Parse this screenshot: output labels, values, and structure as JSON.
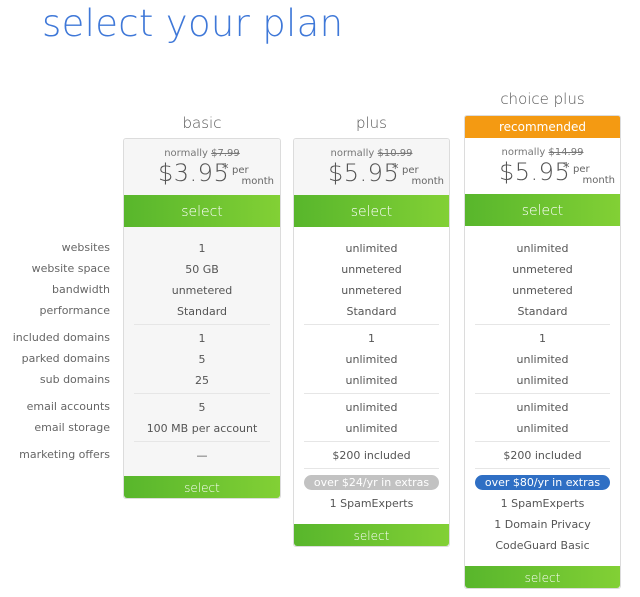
{
  "page": {
    "title": "select your plan"
  },
  "features": {
    "labels": [
      "websites",
      "website space",
      "bandwidth",
      "performance",
      "included domains",
      "parked domains",
      "sub domains",
      "email accounts",
      "email storage",
      "marketing offers"
    ]
  },
  "plans": [
    {
      "name": "basic",
      "recommended_label": null,
      "normally_label": "normally",
      "original_price": "$7.99",
      "price": "$3.95",
      "asterisk": "*",
      "per_line1": "per",
      "per_line2": "month",
      "select_label": "select",
      "values": [
        "1",
        "50 GB",
        "unmetered",
        "Standard",
        "1",
        "5",
        "25",
        "5",
        "100 MB per account",
        "—"
      ],
      "extras_badge": null,
      "extras": [],
      "bottom_select_label": "select"
    },
    {
      "name": "plus",
      "recommended_label": null,
      "normally_label": "normally",
      "original_price": "$10.99",
      "price": "$5.95",
      "asterisk": "*",
      "per_line1": "per",
      "per_line2": "month",
      "select_label": "select",
      "values": [
        "unlimited",
        "unmetered",
        "unmetered",
        "Standard",
        "1",
        "unlimited",
        "unlimited",
        "unlimited",
        "unlimited",
        "$200 included"
      ],
      "extras_badge": "over $24/yr in extras",
      "extras": [
        "1 SpamExperts"
      ],
      "bottom_select_label": "select"
    },
    {
      "name": "choice plus",
      "recommended_label": "recommended",
      "normally_label": "normally",
      "original_price": "$14.99",
      "price": "$5.95",
      "asterisk": "*",
      "per_line1": "per",
      "per_line2": "month",
      "select_label": "select",
      "values": [
        "unlimited",
        "unmetered",
        "unmetered",
        "Standard",
        "1",
        "unlimited",
        "unlimited",
        "unlimited",
        "unlimited",
        "$200 included"
      ],
      "extras_badge": "over $80/yr in extras",
      "extras": [
        "1 SpamExperts",
        "1 Domain Privacy",
        "CodeGuard Basic"
      ],
      "bottom_select_label": "select"
    }
  ],
  "colors": {
    "title": "#3f78d8",
    "select_green_start": "#58b62c",
    "select_green_end": "#82d035",
    "recommended_orange": "#f49a12",
    "badge_gray": "#c2c2c2",
    "badge_blue": "#2f6fc4"
  }
}
